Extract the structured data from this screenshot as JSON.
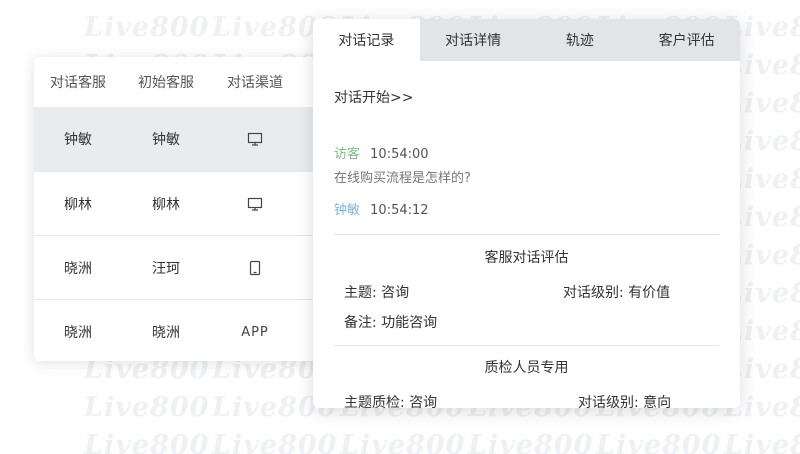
{
  "watermark": {
    "text": "Live800"
  },
  "left_table": {
    "headers": [
      "对话客服",
      "初始客服",
      "对话渠道"
    ],
    "rows": [
      {
        "agent": "钟敏",
        "initial": "钟敏",
        "channel_icon": "desktop-icon",
        "channel_text": ""
      },
      {
        "agent": "柳林",
        "initial": "柳林",
        "channel_icon": "desktop-icon",
        "channel_text": ""
      },
      {
        "agent": "晓洲",
        "initial": "汪珂",
        "channel_icon": "mobile-icon",
        "channel_text": ""
      },
      {
        "agent": "晓洲",
        "initial": "晓洲",
        "channel_icon": "app-text",
        "channel_text": "APP"
      }
    ]
  },
  "chat_panel": {
    "tabs": [
      "对话记录",
      "对话详情",
      "轨迹",
      "客户评估"
    ],
    "active_tab": 0,
    "conversation_start": "对话开始>>",
    "messages": [
      {
        "sender": "访客",
        "time": "10:54:00",
        "text": "在线购买流程是怎样的?"
      },
      {
        "sender": "钟敏",
        "time": "10:54:12",
        "text": ""
      }
    ],
    "evaluation": {
      "title": "客服对话评估",
      "topic_label": "主题:",
      "topic_value": "咨询",
      "level_label": "对话级别:",
      "level_value": "有价值",
      "note_label": "备注:",
      "note_value": "功能咨询"
    },
    "qa": {
      "title": "质检人员专用",
      "topic_label": "主题质检:",
      "topic_value": "咨询",
      "level_label": "对话级别:",
      "level_value": "意向"
    }
  },
  "colors": {
    "visitor": "#7cc07a",
    "agent": "#7fb3e0",
    "tab_bar": "#e2e4e7",
    "selected_row": "#e9ebee",
    "watermark": "#eef0f3"
  }
}
